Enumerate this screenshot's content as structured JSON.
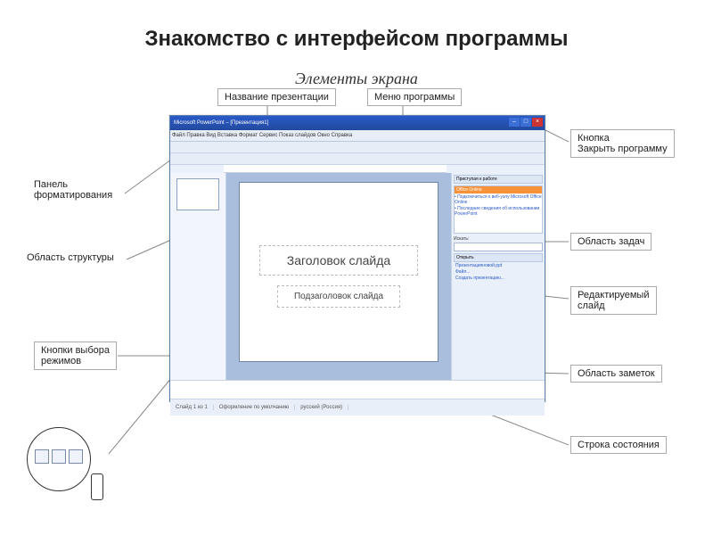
{
  "page": {
    "title": "Знакомство с интерфейсом программы",
    "subtitle": "Элементы экрана"
  },
  "app": {
    "title": "Microsoft PowerPoint – [Презентация1]",
    "menu": "Файл  Правка  Вид  Вставка  Формат  Сервис  Показ слайдов  Окно  Справка",
    "slide_title": "Заголовок слайда",
    "slide_sub": "Подзаголовок слайда",
    "taskpane": {
      "header": "Приступая к работе",
      "office": "Office Online",
      "open": "Открыть",
      "file1": "Презентацияновой.ppt",
      "file2": "Файл...",
      "create": "Создать презентацию..."
    },
    "status": {
      "cell1": "Слайд 1 из 1",
      "cell2": "Оформление по умолчанию",
      "cell3": "русский (Россия)"
    }
  },
  "labels": {
    "l_title": "Название презентации",
    "l_menu": "Меню программы",
    "l_close": "Кнопка\nЗакрыть программу",
    "l_fmt": "Панель\nформатирования",
    "l_outline": "Область  структуры",
    "l_views": "Кнопки выбора\nрежимов",
    "l_taskpane": "Область задач",
    "l_slide": "Редактируемый\nслайд",
    "l_notes": "Область заметок",
    "l_status": "Строка состояния"
  }
}
